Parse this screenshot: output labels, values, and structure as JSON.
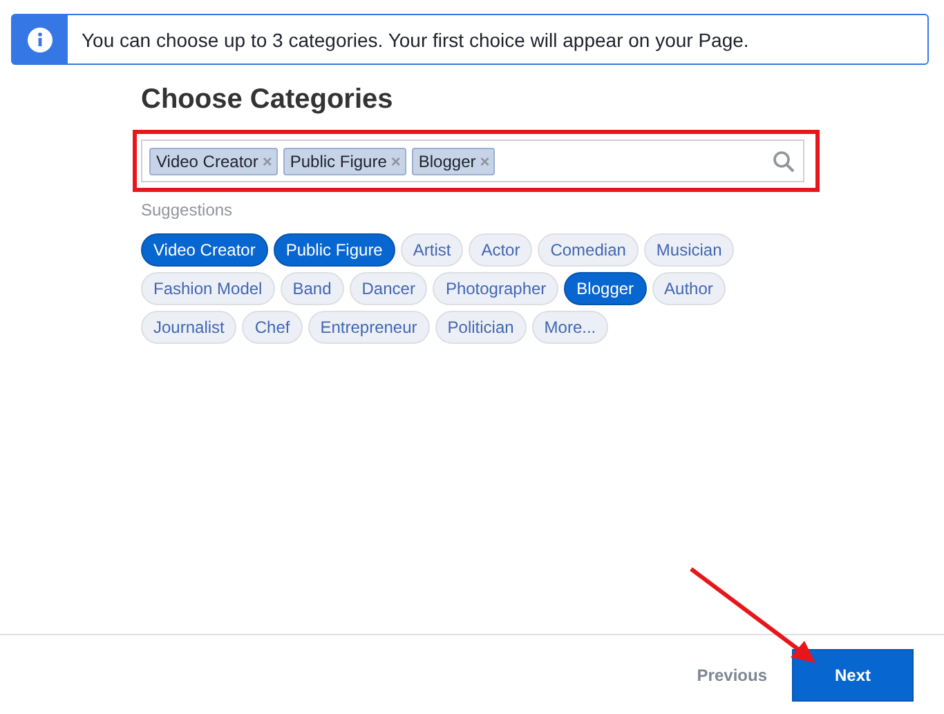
{
  "notice": {
    "text": "You can choose up to 3 categories. Your first choice will appear on your Page."
  },
  "heading": "Choose Categories",
  "field": {
    "tokens": [
      "Video Creator",
      "Public Figure",
      "Blogger"
    ],
    "remove_glyph": "×",
    "highlighted": true
  },
  "suggestions_label": "Suggestions",
  "suggestions": [
    {
      "label": "Video Creator",
      "selected": true
    },
    {
      "label": "Public Figure",
      "selected": true
    },
    {
      "label": "Artist",
      "selected": false
    },
    {
      "label": "Actor",
      "selected": false
    },
    {
      "label": "Comedian",
      "selected": false
    },
    {
      "label": "Musician",
      "selected": false
    },
    {
      "label": "Fashion Model",
      "selected": false
    },
    {
      "label": "Band",
      "selected": false
    },
    {
      "label": "Dancer",
      "selected": false
    },
    {
      "label": "Photographer",
      "selected": false
    },
    {
      "label": "Blogger",
      "selected": true
    },
    {
      "label": "Author",
      "selected": false
    },
    {
      "label": "Journalist",
      "selected": false
    },
    {
      "label": "Chef",
      "selected": false
    },
    {
      "label": "Entrepreneur",
      "selected": false
    },
    {
      "label": "Politician",
      "selected": false
    },
    {
      "label": "More...",
      "selected": false
    }
  ],
  "footer": {
    "previous": "Previous",
    "next": "Next"
  },
  "annotation": {
    "arrow": true
  }
}
